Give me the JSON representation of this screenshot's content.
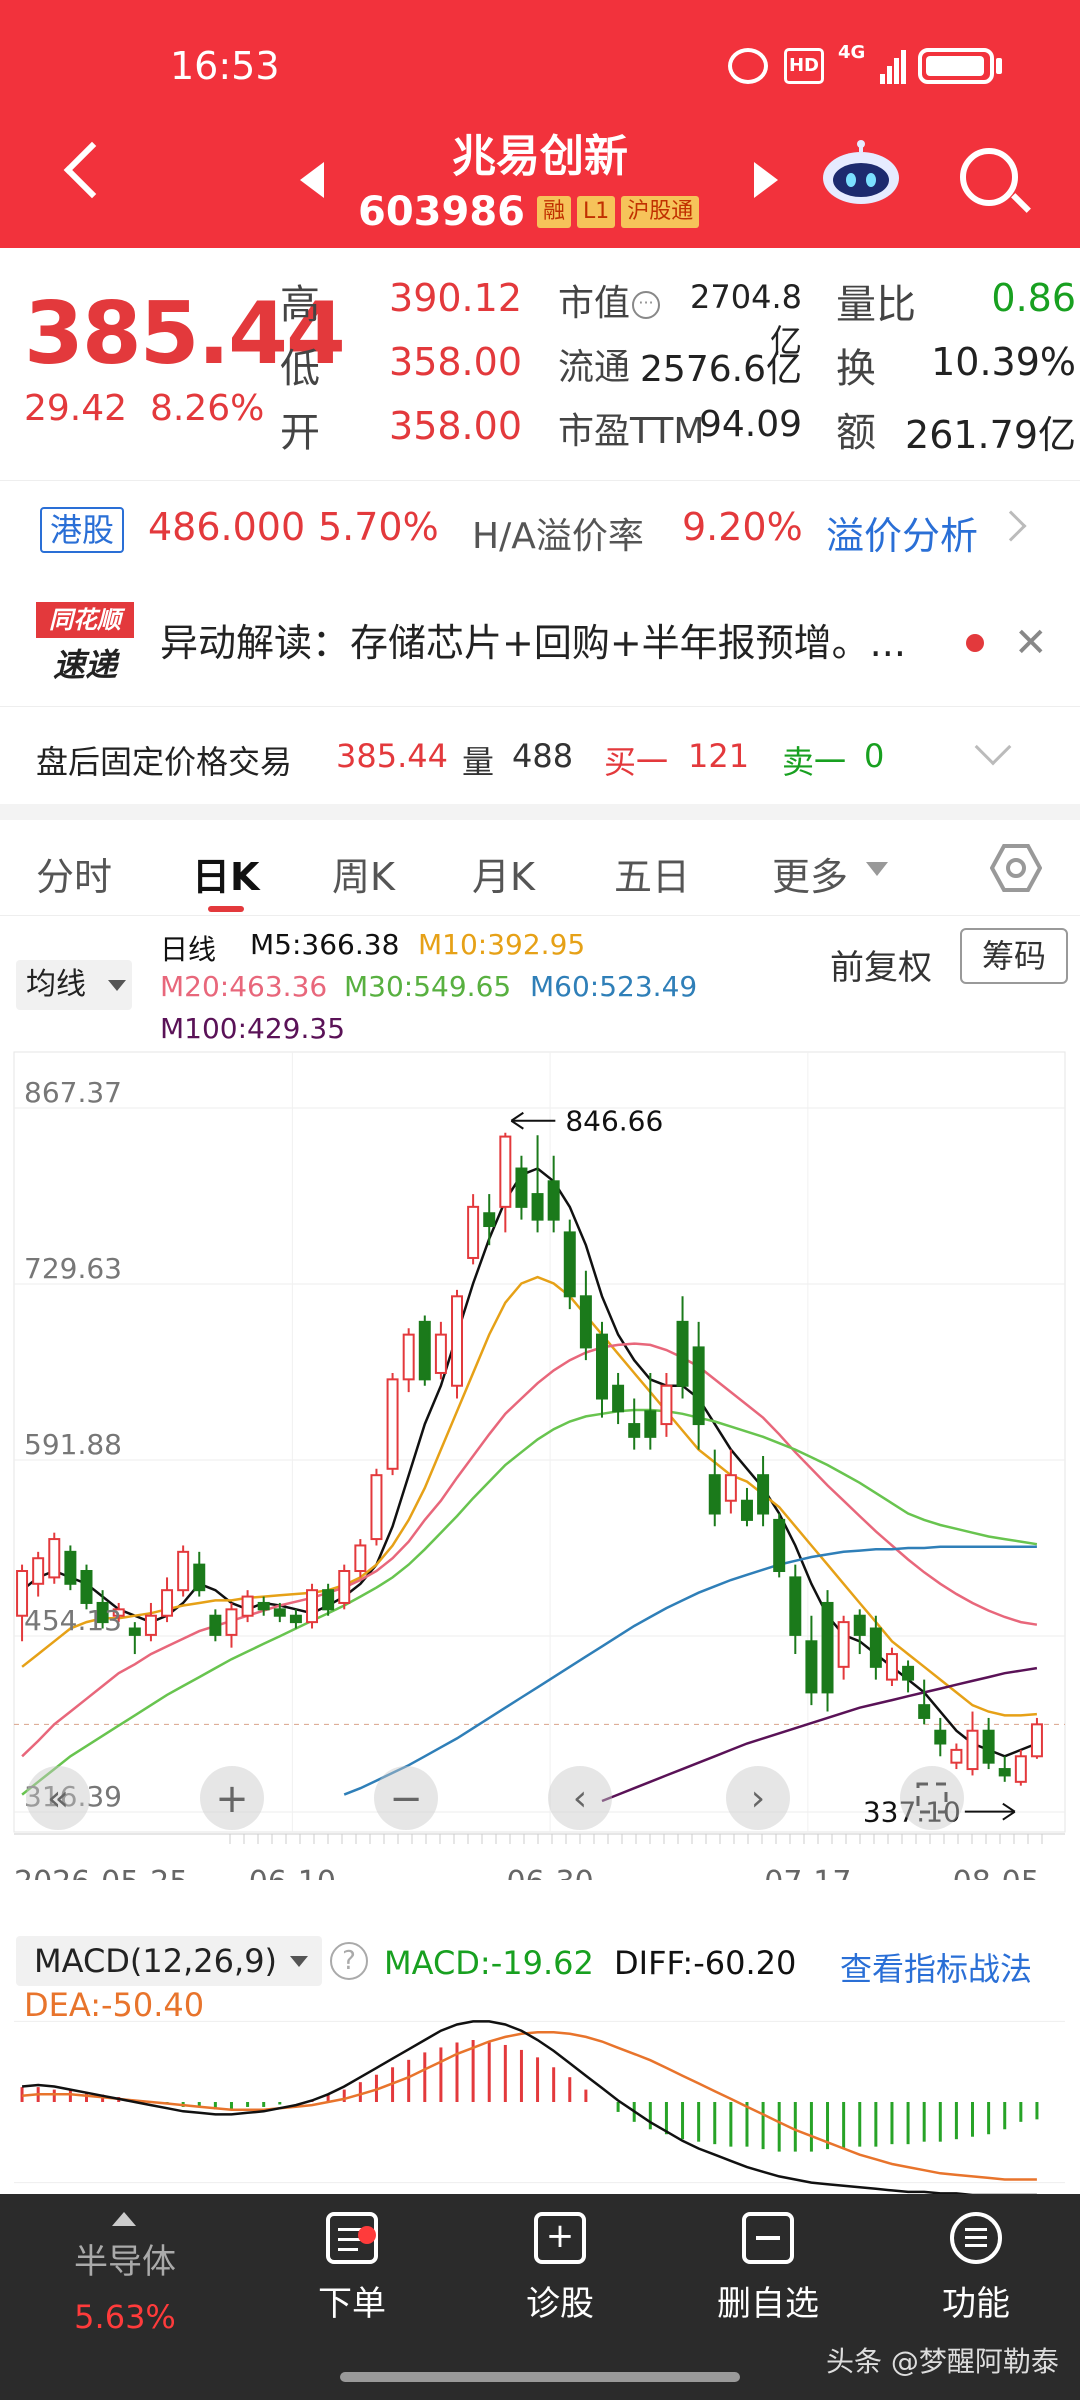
{
  "status_bar": {
    "time": "16:53",
    "hd": "HD",
    "network": "4G"
  },
  "header": {
    "stock_name": "兆易创新",
    "stock_code": "603986",
    "tags": [
      "融",
      "L1",
      "沪股通"
    ]
  },
  "quote": {
    "price": "385.44",
    "change": "29.42",
    "change_pct": "8.26%",
    "labels": {
      "high": "高",
      "low": "低",
      "open": "开",
      "mktcap": "市值",
      "float": "流通",
      "pe": "市盈TTM",
      "vol_ratio": "量比",
      "turnover": "换",
      "amount": "额"
    },
    "high": "390.12",
    "low": "358.00",
    "open": "358.00",
    "mktcap": "2704.8亿",
    "float": "2576.6亿",
    "pe": "94.09",
    "vol_ratio": "0.86",
    "turnover": "10.39%",
    "amount": "261.79亿"
  },
  "hk": {
    "badge": "港股",
    "price": "486.000",
    "pct": "5.70%",
    "premium_label": "H/A溢价率",
    "premium": "9.20%",
    "link": "溢价分析"
  },
  "news": {
    "logo_top": "同花顺",
    "logo_bottom": "速递",
    "text": "异动解读：存储芯片+回购+半年报预增。..."
  },
  "after_hours": {
    "label": "盘后固定价格交易",
    "price": "385.44",
    "vol_label": "量",
    "vol": "488",
    "buy_label": "买一",
    "buy": "121",
    "sell_label": "卖一",
    "sell": "0"
  },
  "tabs": [
    "分时",
    "日K",
    "周K",
    "月K",
    "五日",
    "更多"
  ],
  "ma_legend": {
    "button": "均线",
    "title": "日线",
    "m5": "M5:366.38",
    "m10": "M10:392.95",
    "m20": "M20:463.36",
    "m30": "M30:549.65",
    "m60": "M60:523.49",
    "m100": "M100:429.35",
    "adjust": "前复权",
    "chip": "筹码"
  },
  "colors": {
    "up": "#e3393c",
    "down": "#1b7a1b",
    "m5": "#111111",
    "m10": "#e6a117",
    "m20": "#e8677b",
    "m30": "#68c44f",
    "m60": "#2f7fb8",
    "m100": "#5a1257"
  },
  "chart_data": {
    "type": "candlestick",
    "y_ticks": [
      "867.37",
      "729.63",
      "591.88",
      "454.13",
      "316.39"
    ],
    "ylim": [
      316.39,
      867.37
    ],
    "x_labels": [
      "2026-05-25",
      "06-10",
      "06-30",
      "07-17",
      "08-05"
    ],
    "annotations": {
      "max": "846.66",
      "min": "337.10"
    },
    "candles": [
      [
        470,
        505,
        450,
        510
      ],
      [
        495,
        515,
        485,
        520
      ],
      [
        500,
        530,
        495,
        535
      ],
      [
        520,
        495,
        490,
        525
      ],
      [
        505,
        480,
        475,
        510
      ],
      [
        480,
        465,
        460,
        490
      ],
      [
        470,
        475,
        465,
        480
      ],
      [
        460,
        455,
        440,
        465
      ],
      [
        455,
        470,
        450,
        480
      ],
      [
        470,
        490,
        465,
        500
      ],
      [
        490,
        520,
        485,
        525
      ],
      [
        510,
        490,
        485,
        520
      ],
      [
        470,
        455,
        450,
        475
      ],
      [
        455,
        475,
        445,
        480
      ],
      [
        470,
        485,
        465,
        490
      ],
      [
        480,
        475,
        470,
        485
      ],
      [
        475,
        470,
        465,
        480
      ],
      [
        470,
        465,
        460,
        475
      ],
      [
        465,
        490,
        460,
        495
      ],
      [
        490,
        475,
        470,
        495
      ],
      [
        480,
        505,
        475,
        510
      ],
      [
        505,
        525,
        500,
        530
      ],
      [
        530,
        580,
        525,
        585
      ],
      [
        585,
        655,
        580,
        660
      ],
      [
        655,
        690,
        645,
        695
      ],
      [
        700,
        655,
        650,
        705
      ],
      [
        660,
        690,
        655,
        700
      ],
      [
        650,
        720,
        640,
        725
      ],
      [
        750,
        790,
        745,
        800
      ],
      [
        785,
        775,
        760,
        800
      ],
      [
        790,
        845,
        770,
        848
      ],
      [
        820,
        790,
        780,
        830
      ],
      [
        800,
        780,
        770,
        846
      ],
      [
        810,
        780,
        770,
        830
      ],
      [
        770,
        720,
        710,
        780
      ],
      [
        720,
        680,
        670,
        740
      ],
      [
        690,
        640,
        625,
        700
      ],
      [
        650,
        630,
        620,
        660
      ],
      [
        620,
        610,
        600,
        640
      ],
      [
        630,
        610,
        600,
        660
      ],
      [
        620,
        650,
        610,
        660
      ],
      [
        700,
        650,
        640,
        720
      ],
      [
        680,
        620,
        600,
        700
      ],
      [
        580,
        550,
        540,
        600
      ],
      [
        560,
        580,
        550,
        600
      ],
      [
        560,
        545,
        540,
        570
      ],
      [
        580,
        550,
        540,
        595
      ],
      [
        545,
        505,
        500,
        550
      ],
      [
        500,
        455,
        440,
        510
      ],
      [
        450,
        410,
        400,
        470
      ],
      [
        480,
        410,
        395,
        490
      ],
      [
        430,
        465,
        420,
        470
      ],
      [
        470,
        455,
        440,
        475
      ],
      [
        460,
        430,
        420,
        470
      ],
      [
        420,
        440,
        415,
        445
      ],
      [
        430,
        420,
        410,
        435
      ],
      [
        400,
        390,
        385,
        420
      ],
      [
        380,
        370,
        360,
        390
      ],
      [
        355,
        365,
        350,
        370
      ],
      [
        350,
        380,
        345,
        395
      ],
      [
        380,
        355,
        350,
        390
      ],
      [
        350,
        345,
        340,
        360
      ],
      [
        340,
        360,
        337,
        365
      ],
      [
        360,
        385,
        358,
        390
      ]
    ],
    "ma": {
      "M5": [
        490,
        500,
        505,
        500,
        495,
        485,
        475,
        470,
        465,
        470,
        480,
        495,
        490,
        480,
        475,
        480,
        478,
        475,
        472,
        478,
        485,
        495,
        510,
        540,
        580,
        620,
        650,
        690,
        730,
        765,
        795,
        815,
        820,
        810,
        790,
        760,
        720,
        690,
        670,
        655,
        650,
        650,
        640,
        620,
        600,
        585,
        570,
        550,
        525,
        495,
        470,
        455,
        450,
        440,
        430,
        420,
        410,
        395,
        380,
        370,
        365,
        360,
        365,
        370
      ],
      "M10": [
        430,
        440,
        450,
        460,
        465,
        468,
        468,
        470,
        472,
        475,
        478,
        480,
        482,
        482,
        484,
        485,
        486,
        487,
        488,
        490,
        494,
        500,
        510,
        525,
        545,
        570,
        600,
        630,
        660,
        690,
        715,
        730,
        735,
        730,
        720,
        705,
        690,
        675,
        660,
        645,
        630,
        615,
        600,
        590,
        580,
        575,
        565,
        555,
        540,
        525,
        510,
        495,
        480,
        465,
        450,
        440,
        430,
        420,
        410,
        400,
        395,
        392,
        392,
        393
      ],
      "M20": [
        360,
        372,
        385,
        395,
        405,
        415,
        425,
        432,
        440,
        446,
        452,
        458,
        462,
        466,
        470,
        474,
        478,
        481,
        484,
        488,
        492,
        498,
        505,
        515,
        528,
        545,
        560,
        578,
        595,
        612,
        628,
        640,
        652,
        662,
        670,
        676,
        680,
        682,
        683,
        682,
        678,
        672,
        665,
        655,
        645,
        635,
        625,
        612,
        598,
        585,
        572,
        560,
        548,
        536,
        525,
        514,
        504,
        495,
        487,
        480,
        474,
        469,
        465,
        463
      ],
      "M30": [
        330,
        340,
        350,
        360,
        368,
        376,
        384,
        392,
        400,
        408,
        415,
        422,
        429,
        436,
        442,
        448,
        454,
        460,
        466,
        472,
        478,
        485,
        492,
        500,
        510,
        522,
        535,
        548,
        562,
        575,
        588,
        598,
        608,
        616,
        622,
        626,
        628,
        630,
        631,
        631,
        630,
        628,
        625,
        622,
        618,
        614,
        610,
        605,
        600,
        594,
        588,
        581,
        574,
        566,
        558,
        550,
        545,
        541,
        538,
        535,
        532,
        530,
        528,
        526
      ],
      "M60": [
        null,
        null,
        null,
        null,
        null,
        null,
        null,
        null,
        null,
        null,
        null,
        null,
        null,
        null,
        null,
        null,
        null,
        null,
        null,
        null,
        330,
        335,
        341,
        347,
        353,
        360,
        367,
        374,
        382,
        390,
        398,
        406,
        414,
        422,
        430,
        438,
        446,
        454,
        462,
        469,
        476,
        482,
        488,
        493,
        498,
        502,
        506,
        510,
        513,
        516,
        518,
        520,
        521,
        522,
        522,
        523,
        523,
        524,
        524,
        524,
        524,
        524,
        524,
        524
      ],
      "M100": [
        null,
        null,
        null,
        null,
        null,
        null,
        null,
        null,
        null,
        null,
        null,
        null,
        null,
        null,
        null,
        null,
        null,
        null,
        null,
        null,
        null,
        null,
        null,
        null,
        null,
        null,
        null,
        null,
        null,
        null,
        null,
        null,
        null,
        null,
        null,
        null,
        325,
        330,
        335,
        340,
        345,
        350,
        355,
        360,
        365,
        370,
        374,
        378,
        382,
        386,
        390,
        394,
        398,
        401,
        404,
        407,
        410,
        413,
        416,
        419,
        422,
        425,
        427,
        429
      ]
    }
  },
  "macd": {
    "button": "MACD(12,26,9)",
    "help": "?",
    "macd": "MACD:-19.62",
    "diff": "DIFF:-60.20",
    "dea": "DEA:-50.40",
    "link": "查看指标战法",
    "hist": [
      6,
      6,
      5,
      5,
      4,
      3,
      2,
      1,
      0,
      -1,
      -2,
      -2,
      -3,
      -3,
      -2,
      -2,
      -1,
      0,
      1,
      3,
      5,
      8,
      11,
      14,
      17,
      20,
      22,
      24,
      25,
      24,
      23,
      21,
      18,
      14,
      10,
      5,
      0,
      -4,
      -8,
      -11,
      -13,
      -15,
      -16,
      -17,
      -18,
      -18,
      -19,
      -20,
      -20,
      -20,
      -19,
      -19,
      -18,
      -18,
      -17,
      -17,
      -16,
      -16,
      -15,
      -14,
      -13,
      -11,
      -8,
      -7
    ],
    "diff_line": [
      10,
      11,
      10,
      8,
      6,
      4,
      2,
      0,
      -2,
      -4,
      -6,
      -7,
      -8,
      -8,
      -7,
      -6,
      -4,
      -2,
      1,
      5,
      10,
      16,
      22,
      28,
      34,
      40,
      46,
      50,
      52,
      52,
      50,
      46,
      40,
      33,
      25,
      17,
      9,
      1,
      -6,
      -13,
      -19,
      -25,
      -30,
      -34,
      -38,
      -42,
      -45,
      -48,
      -50,
      -52,
      -53,
      -54,
      -55,
      -56,
      -57,
      -58,
      -58,
      -59,
      -59,
      -60,
      -60,
      -60,
      -60,
      -60
    ],
    "dea_line": [
      4,
      5,
      5,
      5,
      4,
      3,
      2,
      1,
      0,
      -1,
      -2,
      -3,
      -4,
      -5,
      -5,
      -5,
      -4,
      -3,
      -2,
      0,
      2,
      5,
      8,
      12,
      16,
      21,
      26,
      31,
      35,
      39,
      42,
      44,
      45,
      45,
      44,
      42,
      39,
      35,
      31,
      27,
      22,
      17,
      12,
      7,
      2,
      -3,
      -8,
      -13,
      -18,
      -22,
      -26,
      -30,
      -34,
      -37,
      -40,
      -42,
      -44,
      -46,
      -47,
      -48,
      -49,
      -50,
      -50,
      -50
    ]
  },
  "bottom_nav": {
    "sector_name": "半导体",
    "sector_pct": "5.63%",
    "items": [
      "下单",
      "诊股",
      "删自选",
      "功能"
    ]
  },
  "watermark": "头条 @梦醒阿勒泰"
}
